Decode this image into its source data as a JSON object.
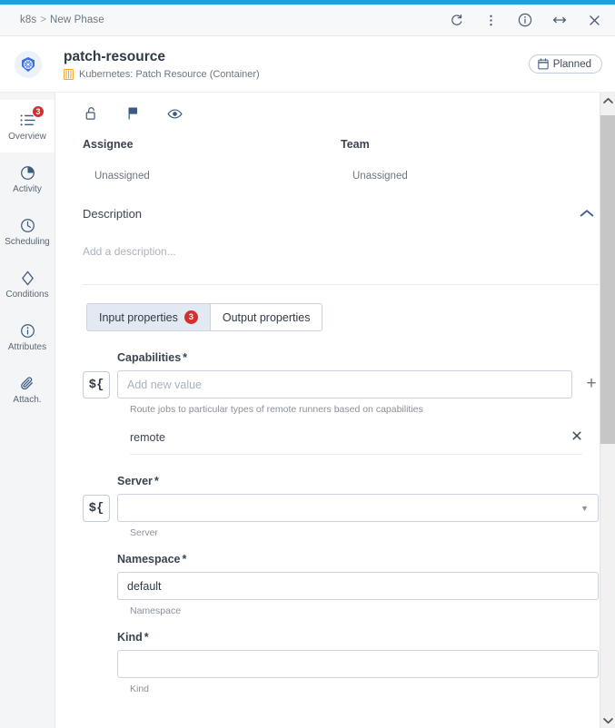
{
  "window": {
    "breadcrumb": {
      "root": "k8s",
      "separator": ">",
      "current": "New Phase"
    },
    "actions": [
      {
        "name": "refresh-icon",
        "label": "Refresh"
      },
      {
        "name": "more-options-icon",
        "label": "More options"
      },
      {
        "name": "info-icon",
        "label": "Info"
      },
      {
        "name": "resize-icon",
        "label": "Expand width"
      },
      {
        "name": "close-icon",
        "label": "Close"
      }
    ],
    "accent_color": "#1ba2da"
  },
  "entity": {
    "avatar_icon": "kubernetes-icon",
    "title": "patch-resource",
    "type_icon": "container-icon",
    "subtitle": "Kubernetes: Patch Resource (Container)",
    "status": {
      "icon": "calendar-icon",
      "label": "Planned"
    }
  },
  "sidebar": {
    "items": [
      {
        "label": "Overview",
        "icon": "list-icon",
        "badge": "3",
        "active": true
      },
      {
        "label": "Activity",
        "icon": "pie-clock-icon",
        "badge": null,
        "active": false
      },
      {
        "label": "Scheduling",
        "icon": "clock-icon",
        "badge": null,
        "active": false
      },
      {
        "label": "Conditions",
        "icon": "diamond-icon",
        "badge": null,
        "active": false
      },
      {
        "label": "Attributes",
        "icon": "info-icon",
        "badge": null,
        "active": false
      },
      {
        "label": "Attach.",
        "icon": "paperclip-icon",
        "badge": null,
        "active": false
      }
    ]
  },
  "toolbar": {
    "icons": [
      {
        "name": "unlock-icon",
        "label": "Unlock"
      },
      {
        "name": "flag-icon",
        "label": "Flag"
      },
      {
        "name": "eye-icon",
        "label": "Watch"
      }
    ]
  },
  "people": {
    "assignee": {
      "label": "Assignee",
      "value": "Unassigned"
    },
    "team": {
      "label": "Team",
      "value": "Unassigned"
    }
  },
  "description": {
    "title": "Description",
    "collapse_icon": "chevron-up-icon",
    "placeholder": "Add a description..."
  },
  "tabs": [
    {
      "label": "Input properties",
      "badge": "3",
      "active": true
    },
    {
      "label": "Output properties",
      "badge": null,
      "active": false
    }
  ],
  "form": {
    "variable_button_label": "${",
    "fields": [
      {
        "label": "Capabilities",
        "required": "*",
        "type": "text-with-add",
        "value": "",
        "placeholder": "Add new value",
        "helper": "Route jobs to particular types of remote runners based on capabilities",
        "has_variable_button": true,
        "add_icon": "plus-icon",
        "chips": [
          {
            "text": "remote",
            "remove_icon": "close-icon"
          }
        ]
      },
      {
        "label": "Server",
        "required": "*",
        "type": "select",
        "value": "",
        "placeholder": "",
        "helper": "Server",
        "has_variable_button": true,
        "caret_icon": "chevron-down-icon"
      },
      {
        "label": "Namespace",
        "required": "*",
        "type": "text",
        "value": "default",
        "placeholder": "",
        "helper": "Namespace",
        "has_variable_button": false
      },
      {
        "label": "Kind",
        "required": "*",
        "type": "text",
        "value": "",
        "placeholder": "",
        "helper": "Kind",
        "has_variable_button": false
      }
    ]
  },
  "scrollbar": {
    "up_icon": "chevron-up-icon",
    "down_icon": "chevron-down-icon"
  }
}
